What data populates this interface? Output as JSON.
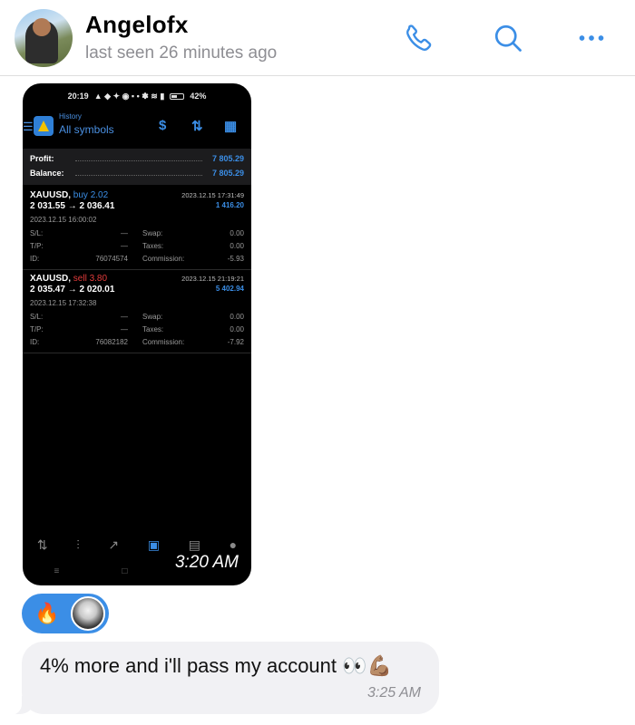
{
  "header": {
    "contact_name": "Angelofx",
    "last_seen": "last seen 26 minutes ago",
    "icons": [
      "phone-icon",
      "search-icon",
      "more-icon"
    ],
    "accent_color": "#3b8ee6"
  },
  "image_message": {
    "time": "3:20 AM",
    "screenshot": {
      "status_time": "20:19",
      "battery": "42%",
      "history_label": "History",
      "symbols_label": "All symbols",
      "summary": {
        "profit_label": "Profit:",
        "profit_value": "7 805.29",
        "balance_label": "Balance:",
        "balance_value": "7 805.29"
      },
      "trades": [
        {
          "symbol": "XAUUSD,",
          "side": "buy 2.02",
          "close_time": "2023.12.15 17:31:49",
          "prices": "2 031.55 → 2 036.41",
          "profit": "1 416.20",
          "open_time": "2023.12.15 16:00:02",
          "sl_label": "S/L:",
          "sl": "—",
          "swap_label": "Swap:",
          "swap": "0.00",
          "tp_label": "T/P:",
          "tp": "—",
          "taxes_label": "Taxes:",
          "taxes": "0.00",
          "id_label": "ID:",
          "id": "76074574",
          "commission_label": "Commission:",
          "commission": "-5.93"
        },
        {
          "symbol": "XAUUSD,",
          "side": "sell 3.80",
          "close_time": "2023.12.15 21:19:21",
          "prices": "2 035.47 → 2 020.01",
          "profit": "5 402.94",
          "open_time": "2023.12.15 17:32:38",
          "sl_label": "S/L:",
          "sl": "—",
          "swap_label": "Swap:",
          "swap": "0.00",
          "tp_label": "T/P:",
          "tp": "—",
          "taxes_label": "Taxes:",
          "taxes": "0.00",
          "id_label": "ID:",
          "id": "76082182",
          "commission_label": "Commission:",
          "commission": "-7.92"
        }
      ]
    }
  },
  "reactions": {
    "emoji": "🔥"
  },
  "text_message": {
    "text": "4% more and i'll pass my account 👀💪🏽",
    "time": "3:25 AM"
  }
}
